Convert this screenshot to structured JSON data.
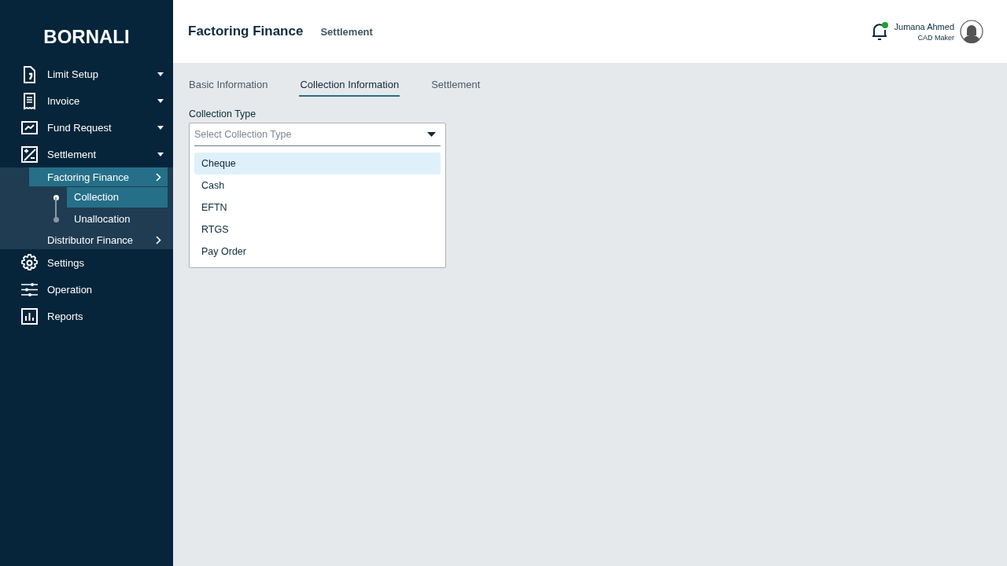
{
  "sidebar": {
    "logo": "BORNALI",
    "items": [
      {
        "label": "Limit Setup",
        "selected": false
      },
      {
        "label": "Invoice",
        "selected": false
      },
      {
        "label": "Fund Request",
        "selected": false
      },
      {
        "label": "Settlement",
        "selected": false,
        "expanded": true,
        "children": [
          {
            "label": "Factoring Finance",
            "selected": true,
            "children": [
              {
                "label": "Collection",
                "selected": true
              },
              {
                "label": "Unallocation",
                "selected": false
              }
            ]
          },
          {
            "label": "Distributor Finance",
            "selected": false
          }
        ]
      },
      {
        "label": "Settings",
        "selected": false
      },
      {
        "label": "Operation",
        "selected": false
      },
      {
        "label": "Reports",
        "selected": false
      }
    ]
  },
  "header": {
    "title": "Factoring Finance",
    "breadcrumb": "Settlement",
    "notification": true,
    "user": {
      "name": "Jumana Ahmed",
      "role": "CAD Maker"
    }
  },
  "tabs": [
    {
      "label": "Basic Information",
      "selected": false
    },
    {
      "label": "Collection Information",
      "selected": true
    },
    {
      "label": "Settlement",
      "selected": false
    }
  ],
  "form": {
    "label": "Collection Type",
    "placeholder": "Select Collection Type",
    "expanded": true,
    "options": [
      {
        "label": "Cheque",
        "selected": true
      },
      {
        "label": "Cash",
        "selected": false
      },
      {
        "label": "EFTN",
        "selected": false
      },
      {
        "label": "RTGS",
        "selected": false
      },
      {
        "label": "Pay Order",
        "selected": false
      }
    ]
  }
}
